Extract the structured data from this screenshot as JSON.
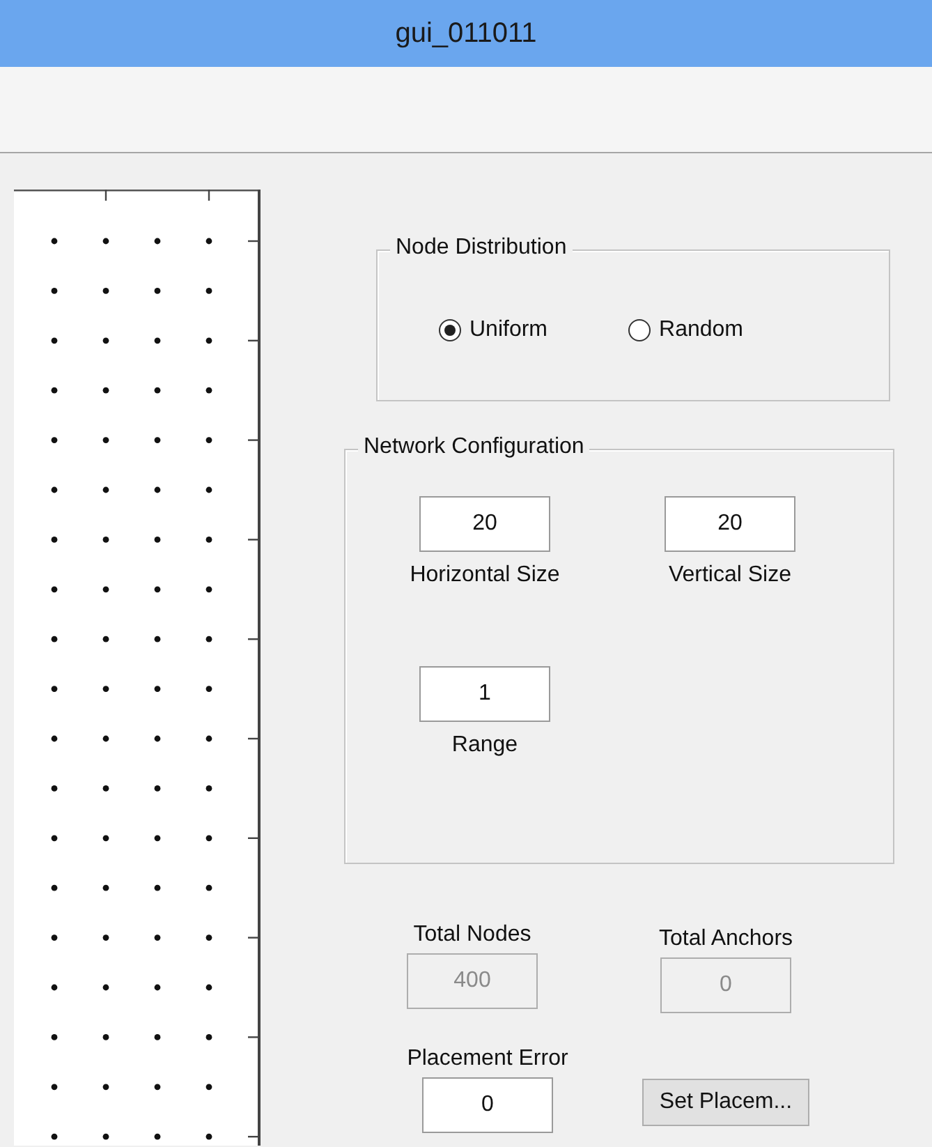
{
  "window": {
    "title": "gui_011011"
  },
  "node_distribution": {
    "title": "Node Distribution",
    "options": [
      {
        "label": "Uniform",
        "selected": true
      },
      {
        "label": "Random",
        "selected": false
      }
    ]
  },
  "network_configuration": {
    "title": "Network Configuration",
    "fields": [
      {
        "label": "Horizontal Size",
        "value": "20"
      },
      {
        "label": "Vertical Size",
        "value": "20"
      },
      {
        "label": "Range",
        "value": "1"
      }
    ]
  },
  "outputs": [
    {
      "label": "Total Nodes",
      "value": "400",
      "disabled": true
    },
    {
      "label": "Total Anchors",
      "value": "0",
      "disabled": true
    },
    {
      "label": "Placement Error",
      "value": "0",
      "disabled": false
    }
  ],
  "buttons": [
    "Set Placem..."
  ]
}
